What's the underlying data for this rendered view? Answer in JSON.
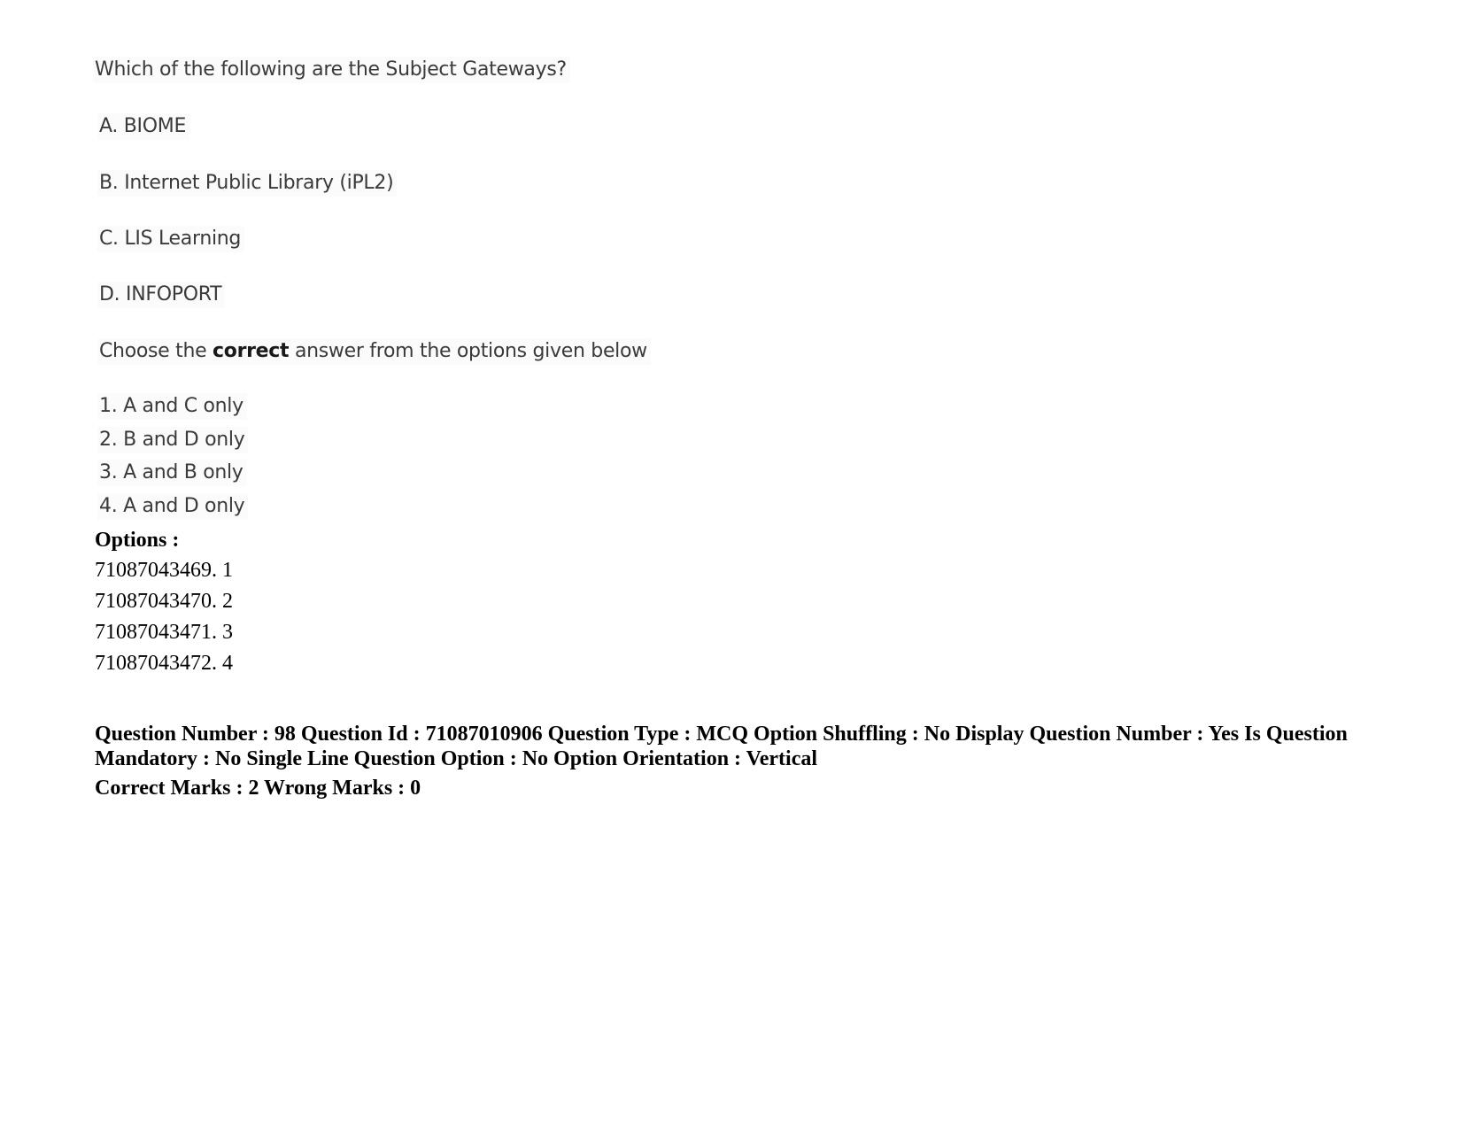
{
  "question": {
    "stem": "Which of the following are the Subject Gateways?",
    "statements": [
      {
        "label": "A.",
        "text": "BIOME"
      },
      {
        "label": "B.",
        "text": "Internet Public Library (iPL2)"
      },
      {
        "label": "C.",
        "text": "LIS Learning"
      },
      {
        "label": "D.",
        "text": "INFOPORT"
      }
    ],
    "instruction": {
      "before": "Choose the ",
      "emphasis": "correct",
      "after": " answer from the options given below"
    },
    "choices": [
      "1. A and C only",
      "2. B and D only",
      "3. A and B only",
      "4. A and D only"
    ]
  },
  "options": {
    "heading": "Options :",
    "items": [
      {
        "id": "71087043469.",
        "value": "1"
      },
      {
        "id": "71087043470.",
        "value": "2"
      },
      {
        "id": "71087043471.",
        "value": "3"
      },
      {
        "id": "71087043472.",
        "value": "4"
      }
    ]
  },
  "metadata": {
    "line1": "Question Number : 98 Question Id : 71087010906 Question Type : MCQ Option Shuffling : No Display Question Number : Yes Is Question Mandatory : No Single Line Question Option : No Option Orientation : Vertical",
    "marks": "Correct Marks : 2 Wrong Marks : 0"
  }
}
